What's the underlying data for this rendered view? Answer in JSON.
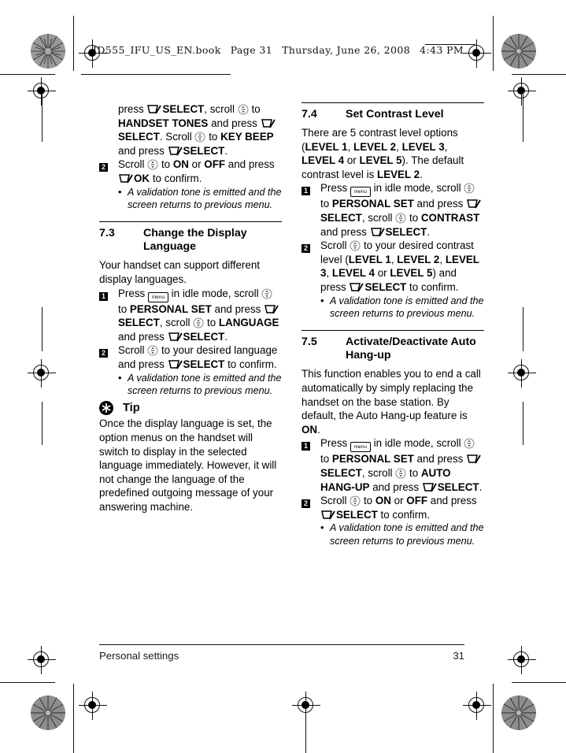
{
  "header": {
    "file": "ID555_IFU_US_EN.book",
    "page": "Page 31",
    "day": "Thursday, June 26, 2008",
    "time": "4:43 PM"
  },
  "footer": {
    "chapter": "Personal settings",
    "page_number": "31"
  },
  "icons": {
    "menu_key_label": "menu",
    "softkey": "softkey-icon",
    "scroll": "scroll-navigation-icon",
    "tip": "tip-asterisk-icon"
  },
  "left_column": {
    "continued_step": {
      "line1_pre": "press ",
      "line1_mid": "SELECT",
      "line1_post": ", scroll ",
      "line1_tail": " to ",
      "bold1": "HANDSET TONES",
      "t1": " and press ",
      "bold2": "SELECT",
      "t2": ". Scroll ",
      "t3": " to ",
      "bold3": "KEY BEEP",
      "t4": " and press ",
      "bold4": "SELECT",
      "t5": "."
    },
    "step2": {
      "num": "2",
      "a": "Scroll ",
      "b": " to ",
      "bold_on": "ON",
      "c": " or ",
      "bold_off": "OFF",
      "d": " and press ",
      "bold_ok": "OK",
      "e": " to confirm."
    },
    "note": "A validation tone is emitted and the screen returns to previous menu.",
    "section": {
      "number": "7.3",
      "title": "Change the Display Language",
      "intro": "Your handset can support different display languages.",
      "step1": {
        "num": "1",
        "a": "Press ",
        "b": " in idle mode, scroll ",
        "c": " to ",
        "bold_personal": "PERSONAL SET",
        "d": " and press ",
        "bold_select1": "SELECT",
        "e": ", scroll ",
        "f": " to ",
        "bold_language": "LANGUAGE",
        "g": " and press ",
        "bold_select2": "SELECT",
        "h": "."
      },
      "step2": {
        "num": "2",
        "a": "Scroll ",
        "b": " to your desired language and press ",
        "bold_select": "SELECT",
        "c": " to confirm."
      },
      "note": "A validation tone is emitted and the screen returns to previous menu."
    },
    "tip": {
      "label": "Tip",
      "text": "Once the display language is set, the option menus on the handset will switch to display in the selected language immediately. However, it will not change the language of the predefined outgoing message of your answering machine."
    }
  },
  "right_column": {
    "section_74": {
      "number": "7.4",
      "title": "Set Contrast Level",
      "intro_a": "There are 5 contrast level options (",
      "lv1": "LEVEL 1",
      "s1": ", ",
      "lv2": "LEVEL 2",
      "s2": ", ",
      "lv3": "LEVEL 3",
      "s3": ", ",
      "lv4": "LEVEL 4",
      "s4": " or ",
      "lv5": "LEVEL 5",
      "intro_b": "). The default contrast level is ",
      "lv_default": "LEVEL 2",
      "intro_c": ".",
      "step1": {
        "num": "1",
        "a": "Press ",
        "b": " in idle mode, scroll ",
        "c": " to ",
        "bold_personal": "PERSONAL SET",
        "d": " and press ",
        "bold_select1": "SELECT",
        "e": ", scroll ",
        "f": " to ",
        "bold_contrast": "CONTRAST",
        "g": " and press ",
        "bold_select2": "SELECT",
        "h": "."
      },
      "step2": {
        "num": "2",
        "a": "Scroll ",
        "b": " to your desired contrast level (",
        "lv1": "LEVEL 1",
        "s1": ", ",
        "lv2": "LEVEL 2",
        "s2": ", ",
        "lv3": "LEVEL 3",
        "s3": ", ",
        "lv4": "LEVEL 4",
        "s4": " or ",
        "lv5": "LEVEL 5",
        "c": ") and press ",
        "bold_select": "SELECT",
        "d": " to confirm."
      },
      "note": "A validation tone is emitted and the screen returns to previous menu."
    },
    "section_75": {
      "number": "7.5",
      "title": "Activate/Deactivate Auto Hang-up",
      "intro_a": "This function enables you to end a call automatically by simply replacing the handset on the base station. By default, the Auto Hang-up feature is ",
      "bold_on": "ON",
      "intro_b": ".",
      "step1": {
        "num": "1",
        "a": "Press ",
        "b": " in idle mode, scroll ",
        "c": " to ",
        "bold_personal": "PERSONAL SET",
        "d": " and press ",
        "bold_select1": "SELECT",
        "e": ", scroll ",
        "f": " to ",
        "bold_auto": "AUTO HANG-UP",
        "g": " and press ",
        "bold_select2": "SELECT",
        "h": "."
      },
      "step2": {
        "num": "2",
        "a": "Scroll ",
        "b": " to ",
        "bold_on": "ON",
        "c": " or ",
        "bold_off": "OFF",
        "d": " and press ",
        "bold_select": "SELECT",
        "e": " to confirm."
      },
      "note": "A validation tone is emitted and the screen returns to previous menu."
    }
  }
}
